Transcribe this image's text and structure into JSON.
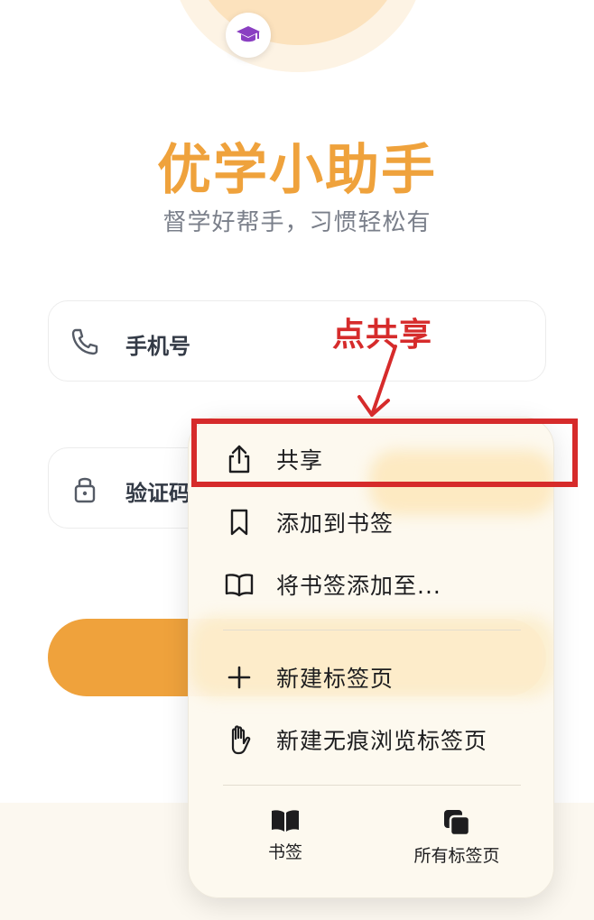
{
  "app": {
    "title": "优学小助手",
    "subtitle": "督学好帮手，习惯轻松有",
    "badge_icon": "graduation-cap-icon",
    "accent_color": "#efa23c"
  },
  "form": {
    "phone_label": "手机号",
    "code_label": "验证码",
    "phone_icon": "phone-icon",
    "code_icon": "lock-icon"
  },
  "menu": {
    "items": [
      {
        "label": "共享",
        "icon": "share-icon"
      },
      {
        "label": "添加到书签",
        "icon": "bookmark-icon"
      },
      {
        "label": "将书签添加至...",
        "icon": "open-book-icon"
      },
      {
        "label": "新建标签页",
        "icon": "plus-icon"
      },
      {
        "label": "新建无痕浏览标签页",
        "icon": "hand-icon"
      }
    ],
    "tabs": [
      {
        "label": "书签",
        "icon": "bookmarks-book-icon"
      },
      {
        "label": "所有标签页",
        "icon": "tabs-stack-icon"
      }
    ]
  },
  "annotation": {
    "text": "点共享",
    "color": "#d62b2b"
  }
}
